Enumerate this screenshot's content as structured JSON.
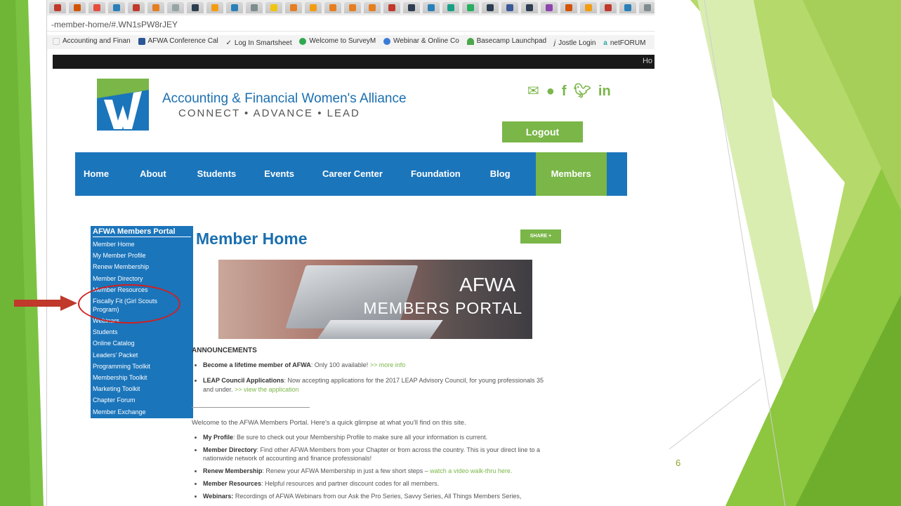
{
  "browser": {
    "url_fragment": "-member-home/#.WN1sPW8rJEY",
    "bookmarks": [
      {
        "label": "Accounting and Finan",
        "icon": "page-icon",
        "color": "#ffffff"
      },
      {
        "label": "AFWA Conference Cal",
        "icon": "calendar-icon",
        "color": "#2b5797"
      },
      {
        "label": "Log In Smartsheet",
        "icon": "checkmark-icon",
        "color": "#333333"
      },
      {
        "label": "Welcome to SurveyM",
        "icon": "surveymonkey-icon",
        "color": "#2fa84f"
      },
      {
        "label": "Webinar & Online Co",
        "icon": "webinar-icon",
        "color": "#3b7bd8"
      },
      {
        "label": "Basecamp Launchpad",
        "icon": "basecamp-icon",
        "color": "#4ca64c"
      },
      {
        "label": "Jostle Login",
        "icon": "jostle-icon",
        "color": "#333333"
      },
      {
        "label": "netFORUM",
        "icon": "netforum-icon",
        "color": "#2aa6a6"
      }
    ],
    "dark_bar_text": "Ho",
    "tab_favicon_colors": [
      "#c0392b",
      "#d35400",
      "#e74c3c",
      "#2980b9",
      "#c0392b",
      "#e67e22",
      "#95a5a6",
      "#2c3e50",
      "#f39c12",
      "#2980b9",
      "#7f8c8d",
      "#f1c40f",
      "#e67e22",
      "#f39c12",
      "#e67e22",
      "#e67e22",
      "#e67e22",
      "#c0392b",
      "#2c3e50",
      "#2980b9",
      "#16a085",
      "#27ae60",
      "#2c3e50",
      "#3b5998",
      "#2c3e50",
      "#8e44ad",
      "#d35400",
      "#f39c12",
      "#c0392b",
      "#2980b9",
      "#7f8c8d"
    ]
  },
  "site": {
    "org_name": "Accounting & Financial Women's Alliance",
    "tagline": "CONNECT • ADVANCE • LEAD",
    "social": [
      "email-icon",
      "chat-icon",
      "facebook-icon",
      "twitter-icon",
      "linkedin-icon"
    ],
    "logout_label": "Logout",
    "nav": [
      "Home",
      "About",
      "Students",
      "Events",
      "Career Center",
      "Foundation",
      "Blog",
      "Members"
    ],
    "colors": {
      "brand_blue": "#1b75bb",
      "brand_green": "#7ab648"
    }
  },
  "sidebar": {
    "title": "AFWA Members Portal",
    "items": [
      "Member Home",
      "My Member Profile",
      "Renew Membership",
      "Member Directory",
      "Member Resources",
      "Fiscally Fit (Girl Scouts Program)",
      "Webinars",
      "Students",
      "Online Catalog",
      "Leaders' Packet",
      "Programming Toolkit",
      "Membership Toolkit",
      "Marketing Toolkit",
      "Chapter Forum",
      "Member Exchange"
    ]
  },
  "main": {
    "title": "Member Home",
    "share_label": "SHARE +",
    "banner_line1": "AFWA",
    "banner_line2": "MEMBERS PORTAL",
    "announcements_heading": "ANNOUNCEMENTS",
    "announcements": [
      {
        "bold": "Become a lifetime member of AFWA",
        "text": ": Only 100 available! ",
        "link": ">> more info"
      },
      {
        "bold": "LEAP Council Applications",
        "text": ": Now accepting applications for the 2017 LEAP Advisory Council, for young professionals 35 and under. ",
        "link": ">> view the application"
      }
    ],
    "welcome": "Welcome to the AFWA Members Portal.  Here's a quick glimpse at what you'll find on this site.",
    "features": [
      {
        "bold": "My Profile",
        "text": ": Be sure to check out your Membership Profile to make sure all your information is current.",
        "link": ""
      },
      {
        "bold": "Member Directory",
        "text": ": Find other AFWA Members from your Chapter or from across the country. This is your direct line to a nationwide network of accounting and finance professionals!",
        "link": ""
      },
      {
        "bold": "Renew Membership",
        "text": ": Renew your AFWA Membership in just a few short steps – ",
        "link": "watch a video walk-thru here."
      },
      {
        "bold": "Member Resources",
        "text": ": Helpful resources and partner discount codes for all members.",
        "link": ""
      },
      {
        "bold": "Webinars:",
        "text": " Recordings of AFWA Webinars from our Ask the Pro Series, Savvy Series, All Things Members Series,",
        "link": ""
      }
    ]
  },
  "slide": {
    "number": "6",
    "accent": "#8dc63f"
  }
}
